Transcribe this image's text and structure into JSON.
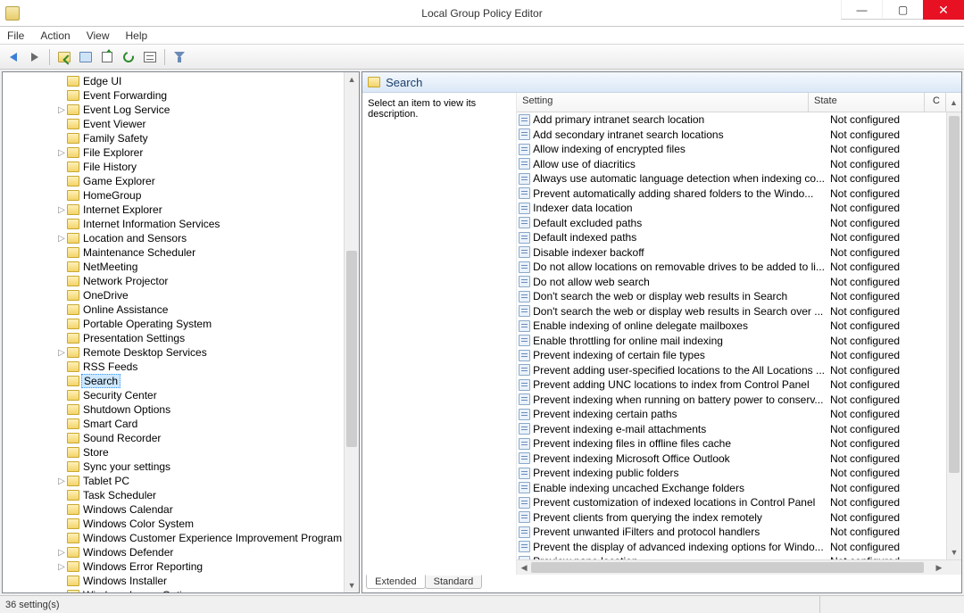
{
  "window": {
    "title": "Local Group Policy Editor"
  },
  "menu": {
    "file": "File",
    "action": "Action",
    "view": "View",
    "help": "Help"
  },
  "tree": {
    "items": [
      {
        "label": "Edge UI",
        "indent": 5,
        "twist": ""
      },
      {
        "label": "Event Forwarding",
        "indent": 5,
        "twist": ""
      },
      {
        "label": "Event Log Service",
        "indent": 5,
        "twist": "▷"
      },
      {
        "label": "Event Viewer",
        "indent": 5,
        "twist": ""
      },
      {
        "label": "Family Safety",
        "indent": 5,
        "twist": ""
      },
      {
        "label": "File Explorer",
        "indent": 5,
        "twist": "▷"
      },
      {
        "label": "File History",
        "indent": 5,
        "twist": ""
      },
      {
        "label": "Game Explorer",
        "indent": 5,
        "twist": ""
      },
      {
        "label": "HomeGroup",
        "indent": 5,
        "twist": ""
      },
      {
        "label": "Internet Explorer",
        "indent": 5,
        "twist": "▷"
      },
      {
        "label": "Internet Information Services",
        "indent": 5,
        "twist": ""
      },
      {
        "label": "Location and Sensors",
        "indent": 5,
        "twist": "▷"
      },
      {
        "label": "Maintenance Scheduler",
        "indent": 5,
        "twist": ""
      },
      {
        "label": "NetMeeting",
        "indent": 5,
        "twist": ""
      },
      {
        "label": "Network Projector",
        "indent": 5,
        "twist": ""
      },
      {
        "label": "OneDrive",
        "indent": 5,
        "twist": ""
      },
      {
        "label": "Online Assistance",
        "indent": 5,
        "twist": ""
      },
      {
        "label": "Portable Operating System",
        "indent": 5,
        "twist": ""
      },
      {
        "label": "Presentation Settings",
        "indent": 5,
        "twist": ""
      },
      {
        "label": "Remote Desktop Services",
        "indent": 5,
        "twist": "▷"
      },
      {
        "label": "RSS Feeds",
        "indent": 5,
        "twist": ""
      },
      {
        "label": "Search",
        "indent": 5,
        "twist": "",
        "selected": true
      },
      {
        "label": "Security Center",
        "indent": 5,
        "twist": ""
      },
      {
        "label": "Shutdown Options",
        "indent": 5,
        "twist": ""
      },
      {
        "label": "Smart Card",
        "indent": 5,
        "twist": ""
      },
      {
        "label": "Sound Recorder",
        "indent": 5,
        "twist": ""
      },
      {
        "label": "Store",
        "indent": 5,
        "twist": ""
      },
      {
        "label": "Sync your settings",
        "indent": 5,
        "twist": ""
      },
      {
        "label": "Tablet PC",
        "indent": 5,
        "twist": "▷"
      },
      {
        "label": "Task Scheduler",
        "indent": 5,
        "twist": ""
      },
      {
        "label": "Windows Calendar",
        "indent": 5,
        "twist": ""
      },
      {
        "label": "Windows Color System",
        "indent": 5,
        "twist": ""
      },
      {
        "label": "Windows Customer Experience Improvement Program",
        "indent": 5,
        "twist": ""
      },
      {
        "label": "Windows Defender",
        "indent": 5,
        "twist": "▷"
      },
      {
        "label": "Windows Error Reporting",
        "indent": 5,
        "twist": "▷"
      },
      {
        "label": "Windows Installer",
        "indent": 5,
        "twist": ""
      },
      {
        "label": "Windows Logon Options",
        "indent": 5,
        "twist": ""
      }
    ]
  },
  "detail": {
    "header": "Search",
    "desc": "Select an item to view its description.",
    "cols": {
      "setting": "Setting",
      "state": "State",
      "c": "C"
    },
    "rows": [
      {
        "s": "Add primary intranet search location",
        "st": "Not configured"
      },
      {
        "s": "Add secondary intranet search locations",
        "st": "Not configured"
      },
      {
        "s": "Allow indexing of encrypted files",
        "st": "Not configured"
      },
      {
        "s": "Allow use of diacritics",
        "st": "Not configured"
      },
      {
        "s": "Always use automatic language detection when indexing co...",
        "st": "Not configured"
      },
      {
        "s": "Prevent automatically adding shared folders to the Windo...",
        "st": "Not configured"
      },
      {
        "s": "Indexer data location",
        "st": "Not configured"
      },
      {
        "s": "Default excluded paths",
        "st": "Not configured"
      },
      {
        "s": "Default indexed paths",
        "st": "Not configured"
      },
      {
        "s": "Disable indexer backoff",
        "st": "Not configured"
      },
      {
        "s": "Do not allow locations on removable drives to be added to li...",
        "st": "Not configured"
      },
      {
        "s": "Do not allow web search",
        "st": "Not configured"
      },
      {
        "s": "Don't search the web or display web results in Search",
        "st": "Not configured"
      },
      {
        "s": "Don't search the web or display web results in Search over ...",
        "st": "Not configured"
      },
      {
        "s": "Enable indexing of online delegate mailboxes",
        "st": "Not configured"
      },
      {
        "s": "Enable throttling for online mail indexing",
        "st": "Not configured"
      },
      {
        "s": "Prevent indexing of certain file types",
        "st": "Not configured"
      },
      {
        "s": "Prevent adding user-specified locations to the All Locations ...",
        "st": "Not configured"
      },
      {
        "s": "Prevent adding UNC locations to index from Control Panel",
        "st": "Not configured"
      },
      {
        "s": "Prevent indexing when running on battery power to conserv...",
        "st": "Not configured"
      },
      {
        "s": "Prevent indexing certain paths",
        "st": "Not configured"
      },
      {
        "s": "Prevent indexing e-mail attachments",
        "st": "Not configured"
      },
      {
        "s": "Prevent indexing files in offline files cache",
        "st": "Not configured"
      },
      {
        "s": "Prevent indexing Microsoft Office Outlook",
        "st": "Not configured"
      },
      {
        "s": "Prevent indexing public folders",
        "st": "Not configured"
      },
      {
        "s": "Enable indexing uncached Exchange folders",
        "st": "Not configured"
      },
      {
        "s": "Prevent customization of indexed locations in Control Panel",
        "st": "Not configured"
      },
      {
        "s": "Prevent clients from querying the index remotely",
        "st": "Not configured"
      },
      {
        "s": "Prevent unwanted iFilters and protocol handlers",
        "st": "Not configured"
      },
      {
        "s": "Prevent the display of advanced indexing options for Windo...",
        "st": "Not configured"
      },
      {
        "s": "Preview pane location",
        "st": "Not configured"
      }
    ],
    "tabs": {
      "extended": "Extended",
      "standard": "Standard"
    }
  },
  "status": {
    "text": "36 setting(s)"
  }
}
